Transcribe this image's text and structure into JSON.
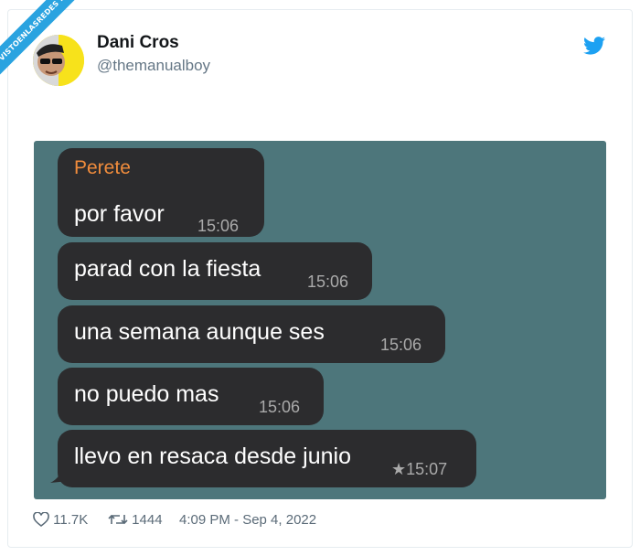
{
  "watermark": {
    "text": "VISTOENLASREDES .com"
  },
  "tweet": {
    "author_name": "Dani Cros",
    "author_handle": "@themanualboy",
    "avatar_icon": "user-avatar",
    "logo_icon": "twitter-bird-icon",
    "brand_color": "#1da1f2"
  },
  "chat": {
    "background_color": "#4d767b",
    "bubble_color": "#2c2c2e",
    "sender_color": "#f08c3c",
    "sender": "Perete",
    "messages": [
      {
        "text": "por favor",
        "time": "15:06"
      },
      {
        "text": "parad con la fiesta",
        "time": "15:06"
      },
      {
        "text": "una semana aunque ses",
        "time": "15:06"
      },
      {
        "text": "no puedo mas",
        "time": "15:06"
      },
      {
        "text": "llevo en resaca desde junio",
        "time": "15:07",
        "starred": true
      }
    ]
  },
  "stats": {
    "likes": "11.7K",
    "retweets": "1444",
    "timestamp": "4:09 PM - Sep 4, 2022"
  }
}
